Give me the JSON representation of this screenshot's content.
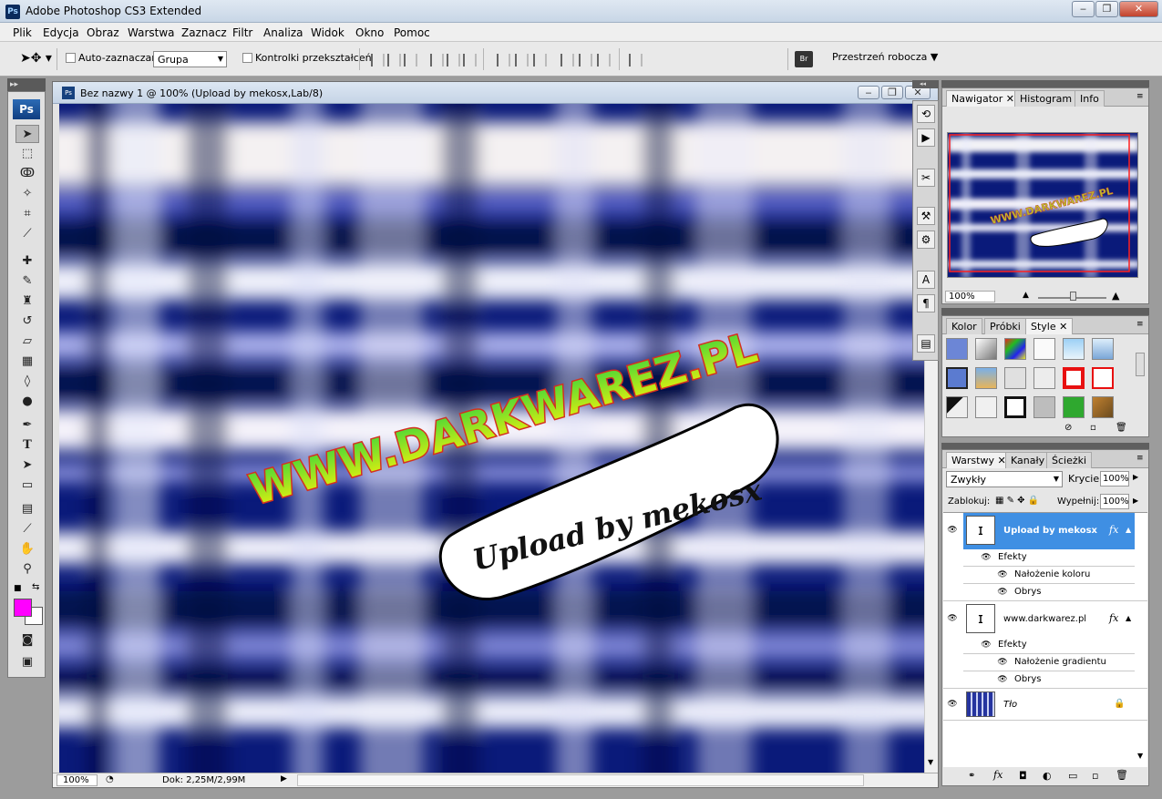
{
  "window": {
    "title": "Adobe Photoshop CS3 Extended",
    "app_icon": "Ps"
  },
  "menu": [
    "Plik",
    "Edycja",
    "Obraz",
    "Warstwa",
    "Zaznacz",
    "Filtr",
    "Analiza",
    "Widok",
    "Okno",
    "Pomoc"
  ],
  "options": {
    "auto_select_label": "Auto-zaznaczanie:",
    "auto_select_value": "Grupa",
    "transform_label": "Kontrolki przekształceń",
    "workspace_label": "Przestrzeń robocza",
    "bridge_icon": "Br"
  },
  "toolbox": {
    "logo": "Ps",
    "grip": "▸▸",
    "foreground_color": "#ff00ff",
    "background_color": "#ffffff"
  },
  "document": {
    "title": "Bez nazwy 1 @ 100% (Upload by mekosx,Lab/8)",
    "zoom": "100%",
    "doc_size": "Dok: 2,25M/2,99M",
    "watermark_main": "WWW.DARKWAREZ.PL",
    "watermark_sub": "Upload by mekosx"
  },
  "navigator": {
    "tabs": [
      "Nawigator",
      "Histogram",
      "Info"
    ],
    "zoom": "100%"
  },
  "styles_panel": {
    "tabs": [
      "Kolor",
      "Próbki",
      "Style"
    ]
  },
  "layers": {
    "tabs": [
      "Warstwy",
      "Kanały",
      "Ścieżki"
    ],
    "blend_mode": "Zwykły",
    "opacity_label": "Krycie:",
    "opacity_value": "100%",
    "lock_label": "Zablokuj:",
    "fill_label": "Wypełnij:",
    "fill_value": "100%",
    "items": [
      {
        "name": "Upload by mekosx",
        "effects_label": "Efekty",
        "effects": [
          "Nałożenie koloru",
          "Obrys"
        ]
      },
      {
        "name": "www.darkwarez.pl",
        "effects_label": "Efekty",
        "effects": [
          "Nałożenie gradientu",
          "Obrys"
        ]
      },
      {
        "name": "Tło"
      }
    ],
    "fx": "fx"
  }
}
